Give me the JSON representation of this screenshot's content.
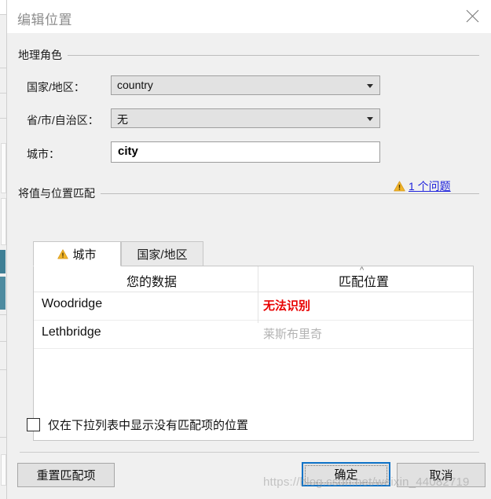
{
  "window": {
    "title": "编辑位置",
    "close_icon": "close-icon"
  },
  "geo_role_group": {
    "title": "地理角色",
    "fields": [
      {
        "label": "国家/地区：",
        "value": "country",
        "type": "combobox"
      },
      {
        "label": "省/市/自治区：",
        "value": "无",
        "type": "combobox"
      },
      {
        "label": "城市：",
        "value": "city",
        "type": "textbox"
      }
    ],
    "issue": {
      "icon": "warning-icon",
      "text": "1 个问题",
      "color": "#1e22dc"
    }
  },
  "match_group": {
    "title": "将值与位置匹配",
    "tabs": [
      {
        "label": "城市",
        "active": true,
        "warning": true
      },
      {
        "label": "国家/地区",
        "active": false,
        "warning": false
      }
    ],
    "table": {
      "columns": [
        "您的数据",
        "匹配位置"
      ],
      "sort_indicator": "^",
      "sort_column": "匹配位置",
      "rows": [
        {
          "your_data": "Woodridge",
          "match": "无法识别",
          "state": "unmatched"
        },
        {
          "your_data": "Lethbridge",
          "match": "莱斯布里奇",
          "state": "matched"
        }
      ]
    },
    "unmatched_color": "#e80000",
    "matched_color": "#b3b3b3"
  },
  "options": {
    "show_unmatched_only": {
      "label": "仅在下拉列表中显示没有匹配项的位置",
      "checked": false
    }
  },
  "footer": {
    "reset_label": "重置匹配项",
    "ok_label": "确定",
    "cancel_label": "取消",
    "default_button_accent": "#0e73c8"
  },
  "watermark": {
    "text": "https://blog.csdn.net/weixin_44082719"
  }
}
